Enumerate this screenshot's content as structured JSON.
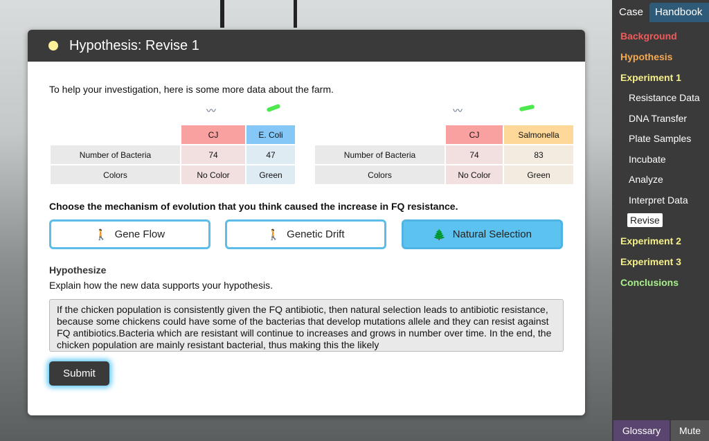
{
  "modal": {
    "title": "Hypothesis: Revise 1",
    "intro": "To help your investigation, here is some more data about the farm.",
    "table1": {
      "headers": [
        "CJ",
        "E. Coli"
      ],
      "rows": [
        {
          "label": "Number of Bacteria",
          "values": [
            "74",
            "47"
          ]
        },
        {
          "label": "Colors",
          "values": [
            "No Color",
            "Green"
          ]
        }
      ]
    },
    "table2": {
      "headers": [
        "CJ",
        "Salmonella"
      ],
      "rows": [
        {
          "label": "Number of Bacteria",
          "values": [
            "74",
            "83"
          ]
        },
        {
          "label": "Colors",
          "values": [
            "No Color",
            "Green"
          ]
        }
      ]
    },
    "question": "Choose the mechanism of evolution that you think caused the increase in FQ resistance.",
    "mechanisms": [
      {
        "label": "Gene Flow",
        "selected": false
      },
      {
        "label": "Genetic Drift",
        "selected": false
      },
      {
        "label": "Natural Selection",
        "selected": true
      }
    ],
    "hypothesize_heading": "Hypothesize",
    "explain": "Explain how the new data supports your hypothesis.",
    "answer": "If the chicken population is consistently given the FQ antibiotic, then natural selection leads to antibiotic resistance, because some chickens could have some of the bacterias that develop mutations allele and they can resist against FQ antibiotics.Bacteria which are resistant will continue to increases and grows in number over time. In the end, the chicken population are mainly resistant bacterial, thus making this the likely",
    "submit": "Submit"
  },
  "sidebar": {
    "tabs": [
      "Case",
      "Handbook"
    ],
    "sections": [
      {
        "label": "Background",
        "color": "#f25a5a"
      },
      {
        "label": "Hypothesis",
        "color": "#f7a94f"
      },
      {
        "label": "Experiment 1",
        "color": "#f6f08a"
      }
    ],
    "steps": [
      "Resistance Data",
      "DNA Transfer",
      "Plate Samples",
      "Incubate",
      "Analyze",
      "Interpret Data",
      "Revise"
    ],
    "later": [
      {
        "label": "Experiment 2",
        "color": "#f6f08a"
      },
      {
        "label": "Experiment 3",
        "color": "#f6f08a"
      },
      {
        "label": "Conclusions",
        "color": "#a6f08a"
      }
    ],
    "glossary": "Glossary",
    "mute": "Mute"
  }
}
